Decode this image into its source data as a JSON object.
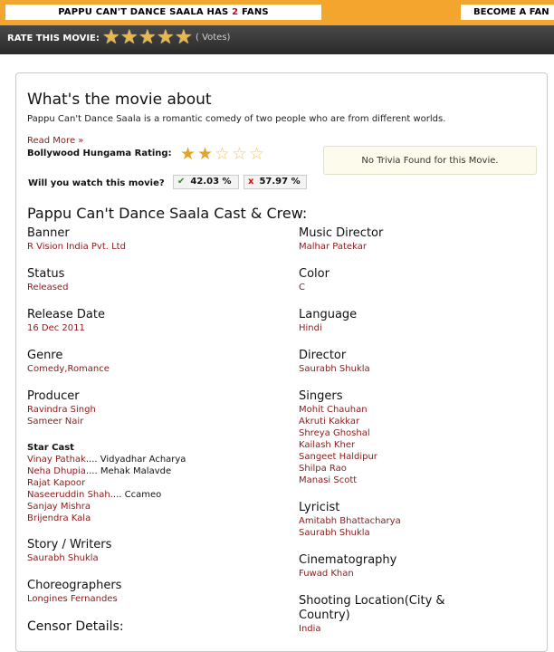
{
  "topbar": {
    "fans_prefix": "PAPPU CAN'T DANCE SAALA HAS ",
    "fans_count": "2",
    "fans_suffix": " FANS",
    "become_fan": "BECOME A FAN"
  },
  "rating_bar": {
    "label": "RATE THIS MOVIE:",
    "stars": 5,
    "votes": "( Votes)"
  },
  "about": {
    "heading": "What's the movie about",
    "synopsis": "Pappu Can't Dance Saala is a romantic comedy of two people who are from different worlds.",
    "read_more": "Read More »",
    "bh_rating_label": "Bollywood Hungama Rating:",
    "bh_rating_value": 2,
    "bh_rating_max": 5,
    "trivia": "No Trivia Found for this Movie.",
    "watch_label": "Will you watch this movie?",
    "yes_pct": "42.03 %",
    "no_pct": "57.97 %"
  },
  "cast_crew": {
    "heading": "Pappu Can't Dance Saala Cast & Crew:",
    "banner_label": "Banner",
    "banner": "R Vision India Pvt. Ltd",
    "status_label": "Status",
    "status": "Released",
    "release_label": "Release Date",
    "release": "16 Dec 2011",
    "genre_label": "Genre",
    "genre": "Comedy,Romance",
    "producer_label": "Producer",
    "producers": [
      "Ravindra Singh",
      "Sameer Nair"
    ],
    "star_cast_label": "Star Cast",
    "star_cast": [
      {
        "actor": "Vinay Pathak",
        "role": ".... Vidyadhar Acharya"
      },
      {
        "actor": "Neha Dhupia",
        "role": ".... Mehak Malavde"
      },
      {
        "actor": "Rajat Kapoor",
        "role": ""
      },
      {
        "actor": "Naseeruddin Shah",
        "role": ".... Ccameo"
      },
      {
        "actor": "Sanjay Mishra",
        "role": ""
      },
      {
        "actor": "Brijendra Kala",
        "role": ""
      }
    ],
    "writers_label": "Story / Writers",
    "writers": "Saurabh Shukla",
    "choreo_label": "Choreographers",
    "choreo": "Longines Fernandes",
    "censor_label": "Censor Details:",
    "music_label": "Music Director",
    "music": "Malhar Patekar",
    "color_label": "Color",
    "color": "C",
    "language_label": "Language",
    "language": "Hindi",
    "director_label": "Director",
    "director": "Saurabh Shukla",
    "singers_label": "Singers",
    "singers": [
      "Mohit Chauhan",
      "Akruti Kakkar",
      "Shreya Ghoshal",
      "Kailash Kher",
      "Sangeet Haldipur",
      "Shilpa Rao",
      "Manasi Scott"
    ],
    "lyricist_label": "Lyricist",
    "lyricists": [
      "Amitabh Bhattacharya",
      "Saurabh Shukla"
    ],
    "cinemato_label": "Cinematography",
    "cinemato": "Fuwad Khan",
    "shooting_label_1": "Shooting Location(City &",
    "shooting_label_2": "Country)",
    "shooting": "India"
  },
  "colors": {
    "topbar": "#f3a52d",
    "link": "#8b1a1a",
    "star": "#e2a52c"
  }
}
